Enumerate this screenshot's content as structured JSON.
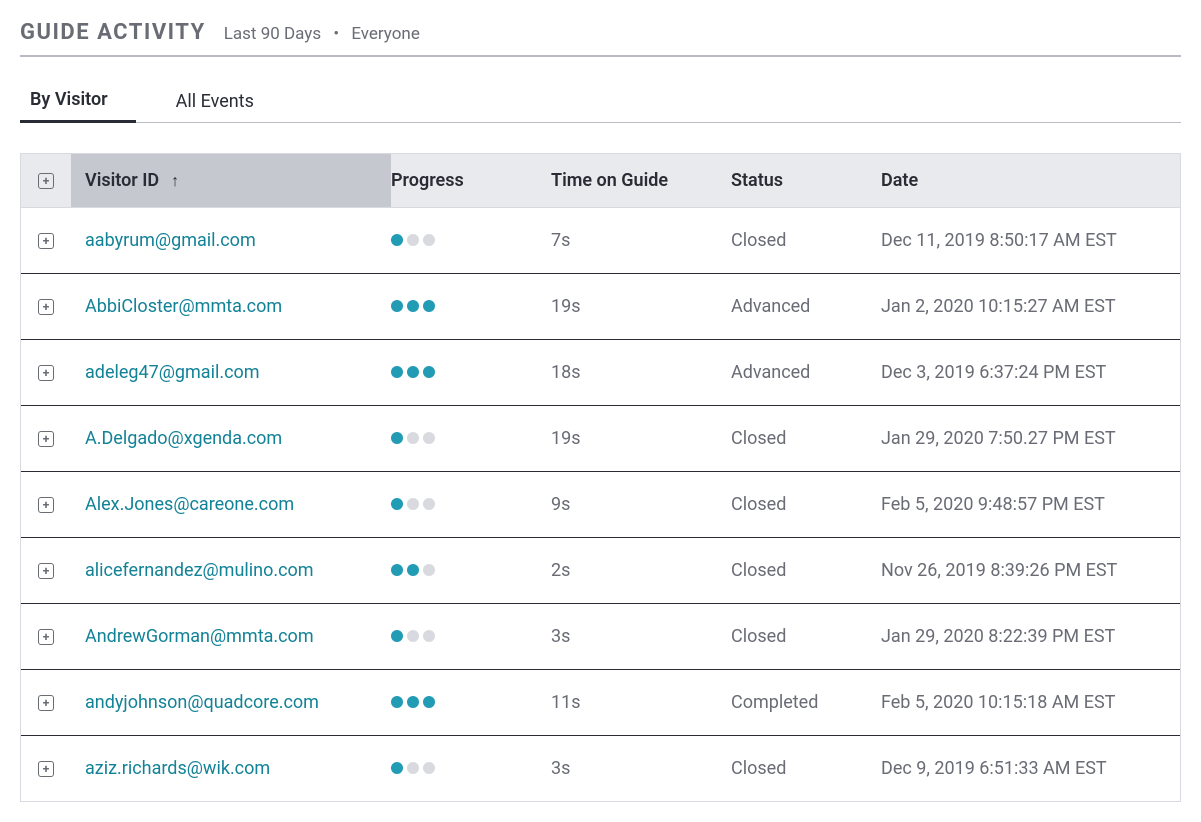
{
  "header": {
    "title": "GUIDE ACTIVITY",
    "filter_range": "Last 90 Days",
    "filter_segment": "Everyone"
  },
  "tabs": {
    "by_visitor": "By Visitor",
    "all_events": "All Events"
  },
  "columns": {
    "visitor": "Visitor ID",
    "progress": "Progress",
    "time": "Time on Guide",
    "status": "Status",
    "date": "Date"
  },
  "sort_arrow": "↑",
  "plus": "+",
  "rows": [
    {
      "visitor": "aabyrum@gmail.com",
      "progress_filled": 1,
      "progress_total": 3,
      "time": "7s",
      "status": "Closed",
      "date": "Dec 11, 2019 8:50:17 AM EST"
    },
    {
      "visitor": "AbbiCloster@mmta.com",
      "progress_filled": 3,
      "progress_total": 3,
      "time": "19s",
      "status": "Advanced",
      "date": "Jan 2, 2020 10:15:27 AM EST"
    },
    {
      "visitor": "adeleg47@gmail.com",
      "progress_filled": 3,
      "progress_total": 3,
      "time": "18s",
      "status": "Advanced",
      "date": "Dec 3, 2019 6:37:24 PM EST"
    },
    {
      "visitor": "A.Delgado@xgenda.com",
      "progress_filled": 1,
      "progress_total": 3,
      "time": "19s",
      "status": "Closed",
      "date": "Jan 29, 2020 7:50.27 PM EST"
    },
    {
      "visitor": "Alex.Jones@careone.com",
      "progress_filled": 1,
      "progress_total": 3,
      "time": "9s",
      "status": "Closed",
      "date": "Feb 5, 2020 9:48:57 PM EST"
    },
    {
      "visitor": "alicefernandez@mulino.com",
      "progress_filled": 2,
      "progress_total": 3,
      "time": "2s",
      "status": "Closed",
      "date": "Nov 26, 2019 8:39:26 PM EST"
    },
    {
      "visitor": "AndrewGorman@mmta.com",
      "progress_filled": 1,
      "progress_total": 3,
      "time": "3s",
      "status": "Closed",
      "date": "Jan 29, 2020 8:22:39 PM EST"
    },
    {
      "visitor": "andyjohnson@quadcore.com",
      "progress_filled": 3,
      "progress_total": 3,
      "time": "11s",
      "status": "Completed",
      "date": "Feb 5, 2020 10:15:18 AM EST"
    },
    {
      "visitor": "aziz.richards@wik.com",
      "progress_filled": 1,
      "progress_total": 3,
      "time": "3s",
      "status": "Closed",
      "date": "Dec 9, 2019 6:51:33 AM EST"
    }
  ]
}
